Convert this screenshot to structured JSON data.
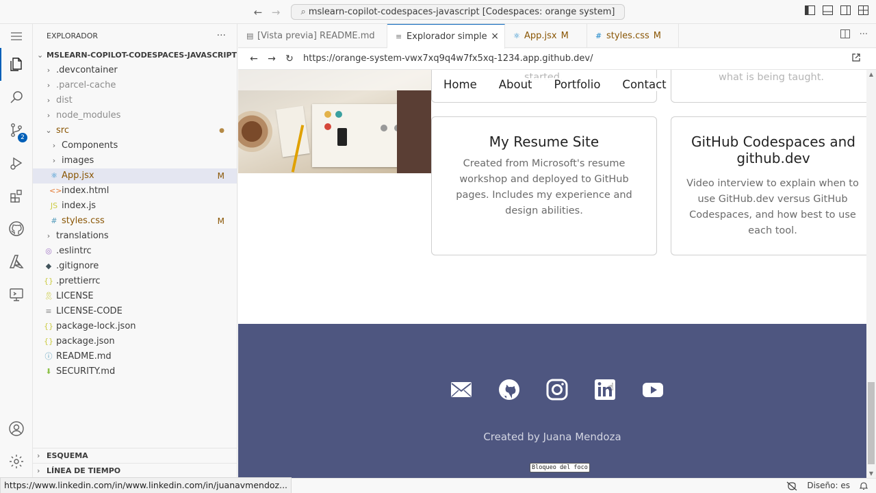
{
  "window": {
    "title": "mslearn-copilot-codespaces-javascript [Codespaces: orange system]"
  },
  "activity_bar": {
    "items": [
      {
        "icon": "files-icon",
        "active": true
      },
      {
        "icon": "search-icon"
      },
      {
        "icon": "source-control-icon",
        "badge": "2"
      },
      {
        "icon": "run-debug-icon"
      },
      {
        "icon": "extensions-icon"
      },
      {
        "icon": "github-icon"
      },
      {
        "icon": "azure-icon"
      },
      {
        "icon": "remote-explorer-icon"
      }
    ],
    "bottom": [
      {
        "icon": "account-icon"
      },
      {
        "icon": "manage-gear-icon"
      }
    ]
  },
  "explorer": {
    "title": "EXPLORADOR",
    "root": "MSLEARN-COPILOT-CODESPACES-JAVASCRIPT [CO...",
    "items": [
      {
        "label": ".devcontainer",
        "type": "folder",
        "depth": 1,
        "state": "normal"
      },
      {
        "label": ".parcel-cache",
        "type": "folder",
        "depth": 1,
        "state": "dimmed"
      },
      {
        "label": "dist",
        "type": "folder",
        "depth": 1,
        "state": "dimmed"
      },
      {
        "label": "node_modules",
        "type": "folder",
        "depth": 1,
        "state": "dimmed"
      },
      {
        "label": "src",
        "type": "folder-open",
        "depth": 1,
        "state": "modified",
        "deco": "●"
      },
      {
        "label": "Components",
        "type": "folder",
        "depth": 2,
        "state": "normal"
      },
      {
        "label": "images",
        "type": "folder",
        "depth": 2,
        "state": "normal"
      },
      {
        "label": "App.jsx",
        "type": "react",
        "depth": 2,
        "state": "modified",
        "deco": "M",
        "selected": true
      },
      {
        "label": "index.html",
        "type": "html",
        "depth": 2,
        "state": "normal"
      },
      {
        "label": "index.js",
        "type": "js",
        "depth": 2,
        "state": "normal"
      },
      {
        "label": "styles.css",
        "type": "css",
        "depth": 2,
        "state": "modified",
        "deco": "M"
      },
      {
        "label": "translations",
        "type": "folder",
        "depth": 1,
        "state": "normal"
      },
      {
        "label": ".eslintrc",
        "type": "eslint",
        "depth": 1,
        "state": "normal"
      },
      {
        "label": ".gitignore",
        "type": "git",
        "depth": 1,
        "state": "normal"
      },
      {
        "label": ".prettierrc",
        "type": "json",
        "depth": 1,
        "state": "normal"
      },
      {
        "label": "LICENSE",
        "type": "license",
        "depth": 1,
        "state": "normal"
      },
      {
        "label": "LICENSE-CODE",
        "type": "text",
        "depth": 1,
        "state": "normal"
      },
      {
        "label": "package-lock.json",
        "type": "json",
        "depth": 1,
        "state": "normal"
      },
      {
        "label": "package.json",
        "type": "json",
        "depth": 1,
        "state": "normal"
      },
      {
        "label": "README.md",
        "type": "info",
        "depth": 1,
        "state": "normal"
      },
      {
        "label": "SECURITY.md",
        "type": "download",
        "depth": 1,
        "state": "normal"
      }
    ],
    "sections": [
      "ESQUEMA",
      "LÍNEA DE TIEMPO"
    ]
  },
  "tabs": [
    {
      "label": "[Vista previa] README.md",
      "icon": "preview-icon",
      "active": false,
      "mod": ""
    },
    {
      "label": "Explorador simple",
      "icon": "file-icon",
      "active": true,
      "mod": ""
    },
    {
      "label": "App.jsx",
      "icon": "react-icon",
      "active": false,
      "mod": "M"
    },
    {
      "label": "styles.css",
      "icon": "css-icon",
      "active": false,
      "mod": "M"
    }
  ],
  "browser": {
    "url": "https://orange-system-vwx7xq9q4w7fx5xq-1234.app.github.dev/"
  },
  "webpage": {
    "nav": [
      "Home",
      "About",
      "Portfolio",
      "Contact"
    ],
    "fragments": {
      "left": "started.",
      "right": "what is being taught."
    },
    "cards": [
      {
        "title": "My Resume Site",
        "description": "Created from Microsoft's resume workshop and deployed to GitHub pages. Includes my experience and design abilities."
      },
      {
        "title": "GitHub Codespaces and github.dev",
        "description": "Video interview to explain when to use GitHub.dev versus GitHub Codespaces, and how best to use each tool."
      }
    ],
    "footer": {
      "social": [
        "email-icon",
        "github-icon",
        "instagram-icon",
        "linkedin-icon",
        "youtube-icon"
      ],
      "credit": "Created by Juana Mendoza",
      "focus_lock": "Bloqueo del foco"
    },
    "colors": {
      "footer_bg": "#4e5680",
      "accent": "#005fb8"
    }
  },
  "status_bar": {
    "hover_url": "https://www.linkedin.com/in/www.linkedin.com/in/juanavmendoz...",
    "layout": "Diseño: es"
  }
}
